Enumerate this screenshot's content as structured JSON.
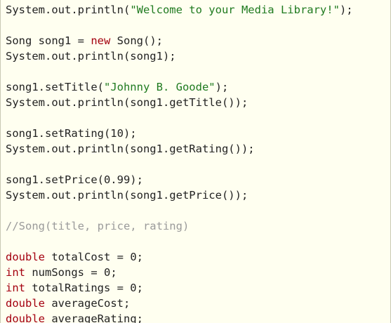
{
  "colors": {
    "background": "#fffff0",
    "default_text": "#222222",
    "keyword": "#a4000f",
    "string": "#1f7a1f",
    "comment": "#9a9a9a"
  },
  "code": {
    "l1_a": "System.out.println(",
    "l1_str": "\"Welcome to your Media Library!\"",
    "l1_b": ");",
    "l3_a": "Song song1 = ",
    "l3_kw": "new",
    "l3_b": " Song();",
    "l4": "System.out.println(song1);",
    "l6_a": "song1.setTitle(",
    "l6_str": "\"Johnny B. Goode\"",
    "l6_b": ");",
    "l7": "System.out.println(song1.getTitle());",
    "l9": "song1.setRating(10);",
    "l10": "System.out.println(song1.getRating());",
    "l12": "song1.setPrice(0.99);",
    "l13": "System.out.println(song1.getPrice());",
    "l15_cmt": "//Song(title, price, rating)",
    "l17_kw": "double",
    "l17_b": " totalCost = 0;",
    "l18_kw": "int",
    "l18_b": " numSongs = 0;",
    "l19_kw": "int",
    "l19_b": " totalRatings = 0;",
    "l20_kw": "double",
    "l20_b": " averageCost;",
    "l21_kw": "double",
    "l21_b": " averageRating;"
  }
}
